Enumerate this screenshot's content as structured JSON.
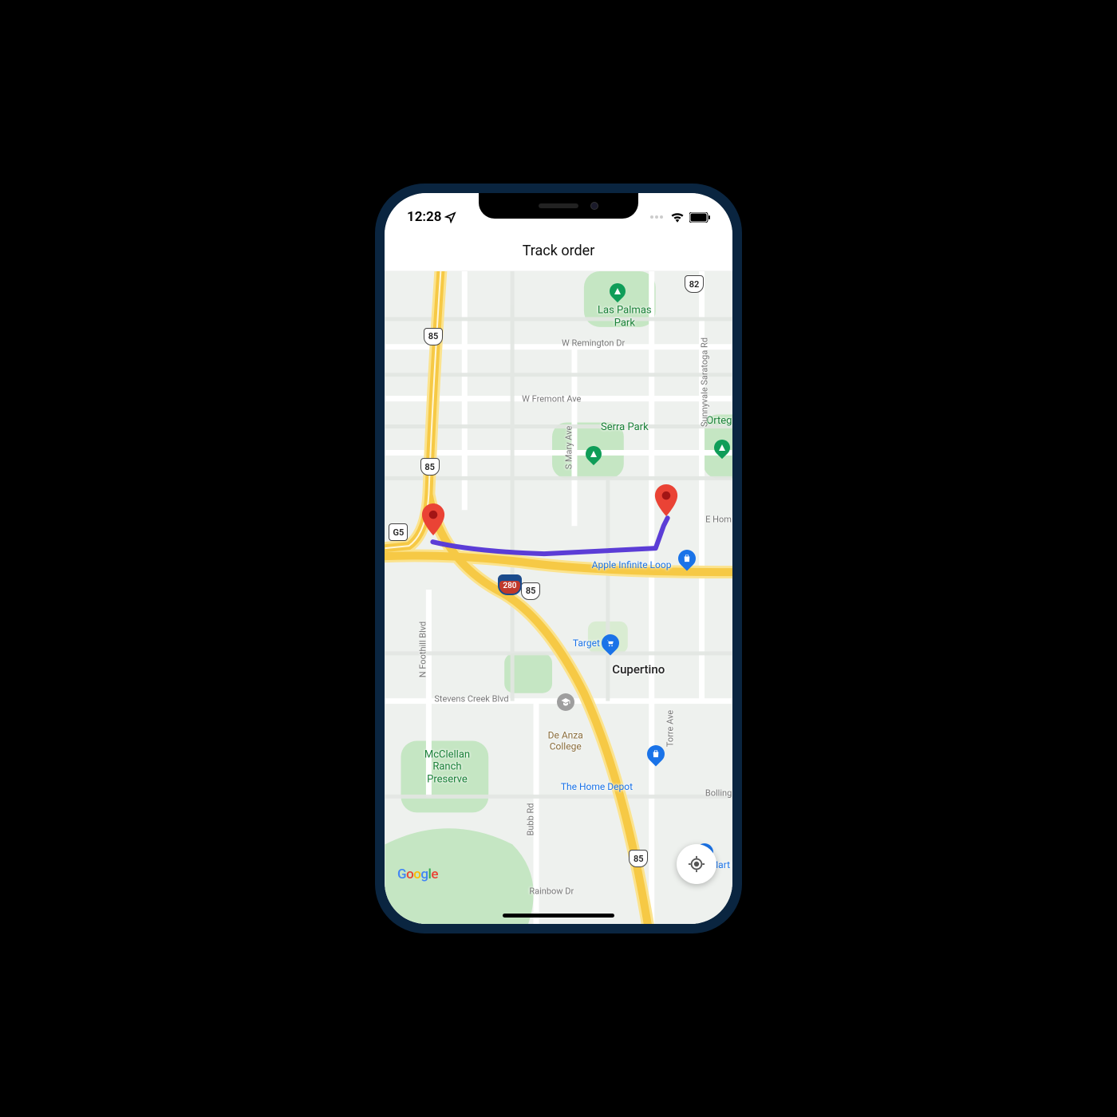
{
  "status_bar": {
    "time": "12:28",
    "icons": [
      "location-arrow",
      "wifi",
      "battery"
    ]
  },
  "header": {
    "title": "Track order"
  },
  "map": {
    "provider": "Google",
    "route": {
      "color": "#5b3dd6"
    },
    "pins": {
      "origin": "red",
      "destination": "red"
    },
    "labels": {
      "las_palmas": "Las Palmas\nPark",
      "serra_park": "Serra Park",
      "ortega": "Ortega",
      "w_remington": "W Remington Dr",
      "w_fremont": "W Fremont Ave",
      "s_mary": "S Mary Ave",
      "sunnyvale_saratoga": "Sunnyvale Saratoga Rd",
      "e_hom": "E Hom",
      "apple_infinite": "Apple Infinite Loop",
      "target": "Target",
      "cupertino": "Cupertino",
      "stevens_creek": "Stevens Creek Blvd",
      "de_anza": "De Anza\nCollege",
      "home_depot": "The Home Depot",
      "bollinger": "Bolling",
      "mcclellan": "McClellan\nRanch\nPreserve",
      "bubb_rd": "Bubb Rd",
      "n_foothill": "N Foothill Blvd",
      "torre_ave": "Torre Ave",
      "rainbow": "Rainbow Dr",
      "hmart": "H Mart Sa"
    },
    "highways": {
      "h82": "82",
      "h85a": "85",
      "h85b": "85",
      "h85c": "85",
      "h85d": "85",
      "g5": "G5",
      "i280": "280"
    }
  }
}
